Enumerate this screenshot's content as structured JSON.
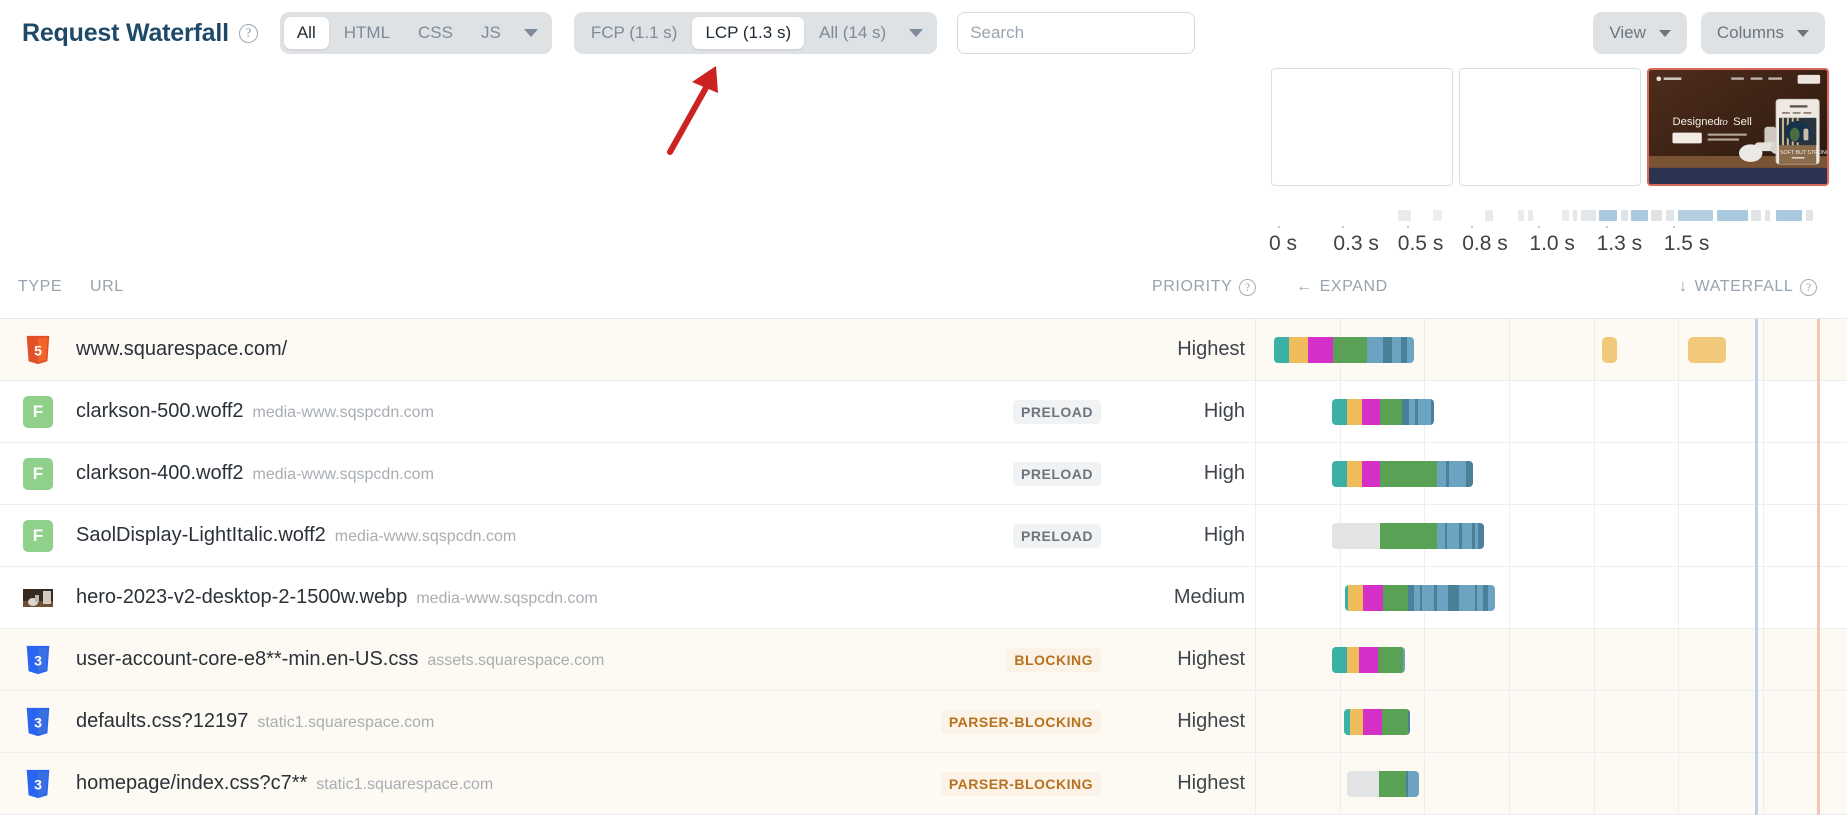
{
  "header": {
    "title": "Request Waterfall",
    "help_icon": "question-circle-icon",
    "type_filter": {
      "options": [
        "All",
        "HTML",
        "CSS",
        "JS"
      ],
      "selected": "All",
      "more_icon": "chevron-down-icon"
    },
    "metric_filter": {
      "options": [
        "FCP (1.1 s)",
        "LCP (1.3 s)",
        "All (14 s)"
      ],
      "selected": "LCP (1.3 s)",
      "more_icon": "chevron-down-icon"
    },
    "search": {
      "value": "",
      "placeholder": "Search",
      "icon": "search-input"
    },
    "view_button": {
      "label": "View",
      "icon": "chevron-down-icon"
    },
    "columns_button": {
      "label": "Columns",
      "icon": "chevron-down-icon"
    }
  },
  "annotation": {
    "type": "red-arrow",
    "points_to": "LCP (1.3 s)",
    "color": "#cc2222"
  },
  "filmstrip": {
    "frames": [
      {
        "label": "frame-blank-1",
        "state": "blank",
        "highlight": false
      },
      {
        "label": "frame-blank-2",
        "state": "blank",
        "highlight": false
      },
      {
        "label": "frame-lcp",
        "state": "rendered",
        "highlight": true,
        "page_headline": "Designed to Sell",
        "brand": "SQUARESPACE",
        "cta": "GET STARTED",
        "card_title": "FOR WHAT IT'S",
        "card_caption": "SOFT BUT STRONG"
      }
    ],
    "axis": {
      "labels": [
        "0 s",
        "0.3 s",
        "0.5 s",
        "0.8 s",
        "1.0 s",
        "1.3 s",
        "1.5 s"
      ],
      "positions_pct": [
        0,
        11.5,
        23,
        34.5,
        46.5,
        58.5,
        70.5
      ]
    },
    "mini_waterfall": [
      {
        "left_pct": 29.5,
        "width_pct": 3.0,
        "color": "#e9eaec"
      },
      {
        "left_pct": 37.5,
        "width_pct": 2.0,
        "color": "#eceef0"
      },
      {
        "left_pct": 49.5,
        "width_pct": 1.8,
        "color": "#e9eaec"
      },
      {
        "left_pct": 57.0,
        "width_pct": 1.4,
        "color": "#e9eaec"
      },
      {
        "left_pct": 59.2,
        "width_pct": 1.2,
        "color": "#e9eaec"
      },
      {
        "left_pct": 67.0,
        "width_pct": 1.6,
        "color": "#e9eaec"
      },
      {
        "left_pct": 69.6,
        "width_pct": 0.9,
        "color": "#e4e6e9"
      },
      {
        "left_pct": 71.5,
        "width_pct": 3.3,
        "color": "#e4e6e9"
      },
      {
        "left_pct": 75.5,
        "width_pct": 4.2,
        "color": "#a9cade"
      },
      {
        "left_pct": 80.6,
        "width_pct": 1.6,
        "color": "#dfe3e6"
      },
      {
        "left_pct": 82.8,
        "width_pct": 4.0,
        "color": "#a9cade"
      },
      {
        "left_pct": 87.4,
        "width_pct": 2.5,
        "color": "#dfe3e6"
      },
      {
        "left_pct": 90.8,
        "width_pct": 2.0,
        "color": "#e2e5e8"
      },
      {
        "left_pct": 93.6,
        "width_pct": 8.0,
        "color": "#b4cfe0"
      },
      {
        "left_pct": 102.6,
        "width_pct": 7.0,
        "color": "#a9cade"
      },
      {
        "left_pct": 110.4,
        "width_pct": 2.2,
        "color": "#e2e5e8"
      },
      {
        "left_pct": 113.6,
        "width_pct": 1.1,
        "color": "#e2e5e8"
      },
      {
        "left_pct": 116.0,
        "width_pct": 6.0,
        "color": "#a9cade"
      },
      {
        "left_pct": 123.0,
        "width_pct": 1.6,
        "color": "#e2e5e8"
      }
    ]
  },
  "columns": {
    "type": "TYPE",
    "url": "URL",
    "priority": "PRIORITY",
    "priority_help": "question-circle-icon",
    "expand": "EXPAND",
    "expand_icon": "arrow-left-icon",
    "waterfall": "WATERFALL",
    "waterfall_icon": "arrow-down-icon",
    "waterfall_help": "question-circle-icon"
  },
  "waterfall_axis": {
    "grid_positions_pct": [
      0,
      14.3,
      28.6,
      42.9,
      57.2,
      71.5,
      85.8
    ],
    "markers": [
      {
        "name": "fcp-marker",
        "label": "FCP",
        "left_pct": 84.5,
        "color": "#bcd2ea"
      },
      {
        "name": "lcp-marker",
        "label": "LCP",
        "left_pct": 95.0,
        "color": "#f0c6b8"
      }
    ],
    "legend_colors": {
      "dns": "#3bb0a4",
      "connect": "#eebc5b",
      "ssl": "#d430c8",
      "ttfb": "#58a155",
      "download": "#6ca3c0",
      "download_alt": "#4c8099",
      "idle": "#e2e3e4",
      "other": "#f2c97a"
    }
  },
  "rows": [
    {
      "icon": "html5-icon",
      "filename": "www.squarespace.com/",
      "host": "",
      "badge": "",
      "badge_kind": "",
      "priority": "Highest",
      "highlight": true,
      "bar": {
        "left_pct": 3.2,
        "segments": [
          {
            "color": "#3bb0a4",
            "w": 2.6
          },
          {
            "color": "#eebc5b",
            "w": 3.2
          },
          {
            "color": "#d430c8",
            "w": 4.2
          },
          {
            "color": "#58a155",
            "w": 5.8
          },
          {
            "color": "#6ca3c0",
            "w": 2.6
          },
          {
            "color": "#4c8099",
            "w": 1.6
          },
          {
            "color": "#6ca3c0",
            "w": 1.4
          },
          {
            "color": "#4c8099",
            "w": 1.1
          },
          {
            "color": "#6ca3c0",
            "w": 1.2
          }
        ]
      },
      "extra_bars": [
        {
          "left_pct": 58.6,
          "width_pct": 2.6,
          "color": "#f2c97a"
        },
        {
          "left_pct": 73.2,
          "width_pct": 6.4,
          "color": "#f2c97a"
        }
      ]
    },
    {
      "icon": "font-icon",
      "filename": "clarkson-500.woff2",
      "host": "media-www.sqspcdn.com",
      "badge": "PRELOAD",
      "badge_kind": "preload",
      "priority": "High",
      "highlight": false,
      "bar": {
        "left_pct": 13.0,
        "segments": [
          {
            "color": "#3bb0a4",
            "w": 2.5
          },
          {
            "color": "#eebc5b",
            "w": 2.5
          },
          {
            "color": "#d430c8",
            "w": 3.2
          },
          {
            "color": "#58a155",
            "w": 3.6
          },
          {
            "color": "#4c8099",
            "w": 1.2
          },
          {
            "color": "#6ca3c0",
            "w": 1.0
          },
          {
            "color": "#4c8099",
            "w": 0.5
          },
          {
            "color": "#6ca3c0",
            "w": 2.2
          },
          {
            "color": "#4c8099",
            "w": 0.6
          }
        ]
      },
      "extra_bars": []
    },
    {
      "icon": "font-icon",
      "filename": "clarkson-400.woff2",
      "host": "media-www.sqspcdn.com",
      "badge": "PRELOAD",
      "badge_kind": "preload",
      "priority": "High",
      "highlight": false,
      "bar": {
        "left_pct": 13.0,
        "segments": [
          {
            "color": "#3bb0a4",
            "w": 2.5
          },
          {
            "color": "#eebc5b",
            "w": 2.5
          },
          {
            "color": "#d430c8",
            "w": 3.2
          },
          {
            "color": "#58a155",
            "w": 9.5
          },
          {
            "color": "#6ca3c0",
            "w": 1.5
          },
          {
            "color": "#4c8099",
            "w": 0.5
          },
          {
            "color": "#6ca3c0",
            "w": 3.0
          },
          {
            "color": "#4c8099",
            "w": 1.2
          }
        ]
      },
      "extra_bars": []
    },
    {
      "icon": "font-icon",
      "filename": "SaolDisplay-LightItalic.woff2",
      "host": "media-www.sqspcdn.com",
      "badge": "PRELOAD",
      "badge_kind": "preload",
      "priority": "High",
      "highlight": false,
      "bar": {
        "left_pct": 13.0,
        "segments": [
          {
            "color": "#e2e3e4",
            "w": 8.2
          },
          {
            "color": "#58a155",
            "w": 9.5
          },
          {
            "color": "#6ca3c0",
            "w": 1.4
          },
          {
            "color": "#4c8099",
            "w": 0.4
          },
          {
            "color": "#6ca3c0",
            "w": 2.0
          },
          {
            "color": "#4c8099",
            "w": 0.5
          },
          {
            "color": "#6ca3c0",
            "w": 1.6
          },
          {
            "color": "#4c8099",
            "w": 0.5
          },
          {
            "color": "#6ca3c0",
            "w": 0.6
          },
          {
            "color": "#4c8099",
            "w": 1.0
          }
        ]
      },
      "extra_bars": []
    },
    {
      "icon": "image-icon",
      "filename": "hero-2023-v2-desktop-2-1500w.webp",
      "host": "media-www.sqspcdn.com",
      "badge": "",
      "badge_kind": "",
      "priority": "Medium",
      "highlight": false,
      "bar": {
        "left_pct": 15.2,
        "segments": [
          {
            "color": "#3bb0a4",
            "w": 0.5
          },
          {
            "color": "#eebc5b",
            "w": 2.6
          },
          {
            "color": "#d430c8",
            "w": 3.4
          },
          {
            "color": "#58a155",
            "w": 4.2
          },
          {
            "color": "#4c8099",
            "w": 1.0
          },
          {
            "color": "#6ca3c0",
            "w": 0.9
          },
          {
            "color": "#4c8099",
            "w": 0.5
          },
          {
            "color": "#6ca3c0",
            "w": 1.9
          },
          {
            "color": "#4c8099",
            "w": 0.6
          },
          {
            "color": "#6ca3c0",
            "w": 1.8
          },
          {
            "color": "#4c8099",
            "w": 1.9
          },
          {
            "color": "#6ca3c0",
            "w": 2.6
          },
          {
            "color": "#4c8099",
            "w": 0.5
          },
          {
            "color": "#6ca3c0",
            "w": 1.0
          },
          {
            "color": "#4c8099",
            "w": 0.7
          },
          {
            "color": "#6ca3c0",
            "w": 1.3
          }
        ]
      },
      "extra_bars": []
    },
    {
      "icon": "css3-icon",
      "filename": "user-account-core-e8**-min.en-US.css",
      "host": "assets.squarespace.com",
      "badge": "BLOCKING",
      "badge_kind": "blocking",
      "priority": "Highest",
      "highlight": true,
      "bar": {
        "left_pct": 13.0,
        "segments": [
          {
            "color": "#3bb0a4",
            "w": 2.6
          },
          {
            "color": "#eebc5b",
            "w": 2.0
          },
          {
            "color": "#d430c8",
            "w": 3.2
          },
          {
            "color": "#58a155",
            "w": 4.2
          },
          {
            "color": "#6ca3c0",
            "w": 0.4
          }
        ]
      },
      "extra_bars": []
    },
    {
      "icon": "css3-icon",
      "filename": "defaults.css?12197",
      "host": "static1.squarespace.com",
      "badge": "PARSER-BLOCKING",
      "badge_kind": "blocking",
      "priority": "Highest",
      "highlight": true,
      "bar": {
        "left_pct": 15.0,
        "segments": [
          {
            "color": "#3bb0a4",
            "w": 1.1
          },
          {
            "color": "#eebc5b",
            "w": 2.2
          },
          {
            "color": "#d430c8",
            "w": 3.2
          },
          {
            "color": "#58a155",
            "w": 4.4
          },
          {
            "color": "#4c8099",
            "w": 0.3
          }
        ]
      },
      "extra_bars": []
    },
    {
      "icon": "css3-icon",
      "filename": "homepage/index.css?c7**",
      "host": "static1.squarespace.com",
      "badge": "PARSER-BLOCKING",
      "badge_kind": "blocking",
      "priority": "Highest",
      "highlight": true,
      "bar": {
        "left_pct": 15.5,
        "segments": [
          {
            "color": "#e2e3e4",
            "w": 5.4
          },
          {
            "color": "#58a155",
            "w": 4.6
          },
          {
            "color": "#4c8099",
            "w": 0.4
          },
          {
            "color": "#6ca3c0",
            "w": 1.8
          }
        ]
      },
      "extra_bars": []
    }
  ]
}
